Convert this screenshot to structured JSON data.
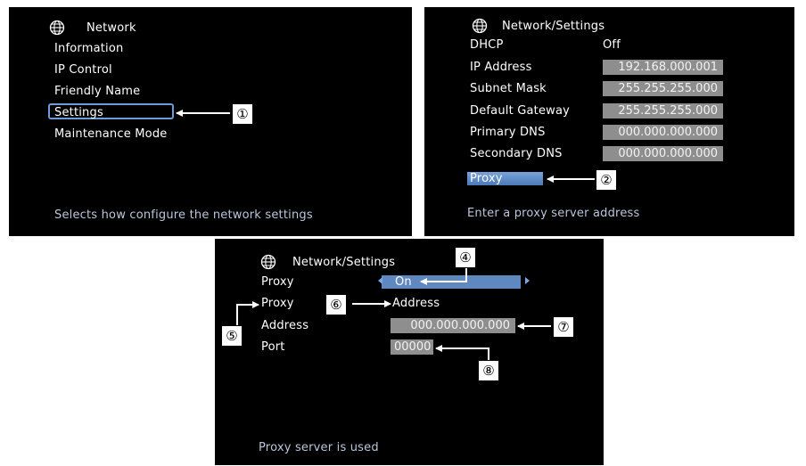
{
  "panel1": {
    "title": "Network",
    "items": [
      "Information",
      "IP Control",
      "Friendly Name",
      "Settings",
      "Maintenance Mode"
    ],
    "hint": "Selects how configure the network settings",
    "callout": "①"
  },
  "panel2": {
    "title": "Network/Settings",
    "dhcp_label": "DHCP",
    "dhcp_value": "Off",
    "rows": [
      {
        "label": "IP Address",
        "value": "192.168.000.001"
      },
      {
        "label": "Subnet Mask",
        "value": "255.255.255.000"
      },
      {
        "label": "Default Gateway",
        "value": "255.255.255.000"
      },
      {
        "label": "Primary DNS",
        "value": "000.000.000.000"
      },
      {
        "label": "Secondary DNS",
        "value": "000.000.000.000"
      }
    ],
    "proxy_label": "Proxy",
    "hint": "Enter a proxy server address",
    "callout": "②"
  },
  "panel3": {
    "title": "Network/Settings",
    "proxy_label": "Proxy",
    "proxy_value": "On",
    "proxy2_label": "Proxy",
    "proxy2_value": "Address",
    "address_label": "Address",
    "address_value": "000.000.000.000",
    "port_label": "Port",
    "port_value": "00000",
    "hint": "Proxy server is used",
    "callouts": {
      "c4": "④",
      "c5": "⑤",
      "c6": "⑥",
      "c7": "⑦",
      "c8": "⑧"
    }
  },
  "colors": {
    "panel_bg": "#000000",
    "hint": "#b9c6dc",
    "value_box": "#8e8e8e",
    "selection": "#5f88c0",
    "highlight_blue": "#4a7ab8"
  },
  "icons": [
    "globe-icon",
    "left-arrow-icon",
    "right-arrow-icon"
  ]
}
